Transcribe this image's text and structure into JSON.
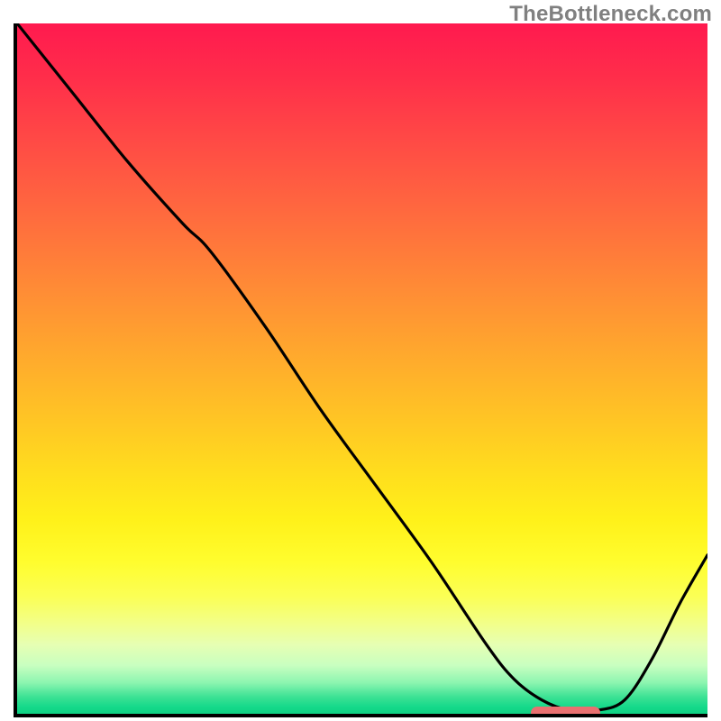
{
  "watermark": "TheBottleneck.com",
  "colors": {
    "frame_border": "#000000",
    "curve_stroke": "#000000",
    "marker_fill": "#e97070",
    "gradient_top": "#ff1a4f",
    "gradient_bottom": "#0fd184"
  },
  "chart_data": {
    "type": "line",
    "title": "",
    "xlabel": "",
    "ylabel": "",
    "xlim": [
      0,
      100
    ],
    "ylim": [
      0,
      100
    ],
    "grid": false,
    "x": [
      0,
      8,
      16,
      24,
      28,
      36,
      44,
      52,
      60,
      68,
      72,
      76,
      80,
      84,
      88,
      92,
      96,
      100
    ],
    "values": [
      100,
      90,
      80,
      71,
      67,
      56,
      44,
      33,
      22,
      10,
      5,
      2,
      0.5,
      0.5,
      2,
      8,
      16,
      23
    ],
    "marker": {
      "x_start": 74,
      "x_end": 84,
      "y": 0.7
    }
  }
}
